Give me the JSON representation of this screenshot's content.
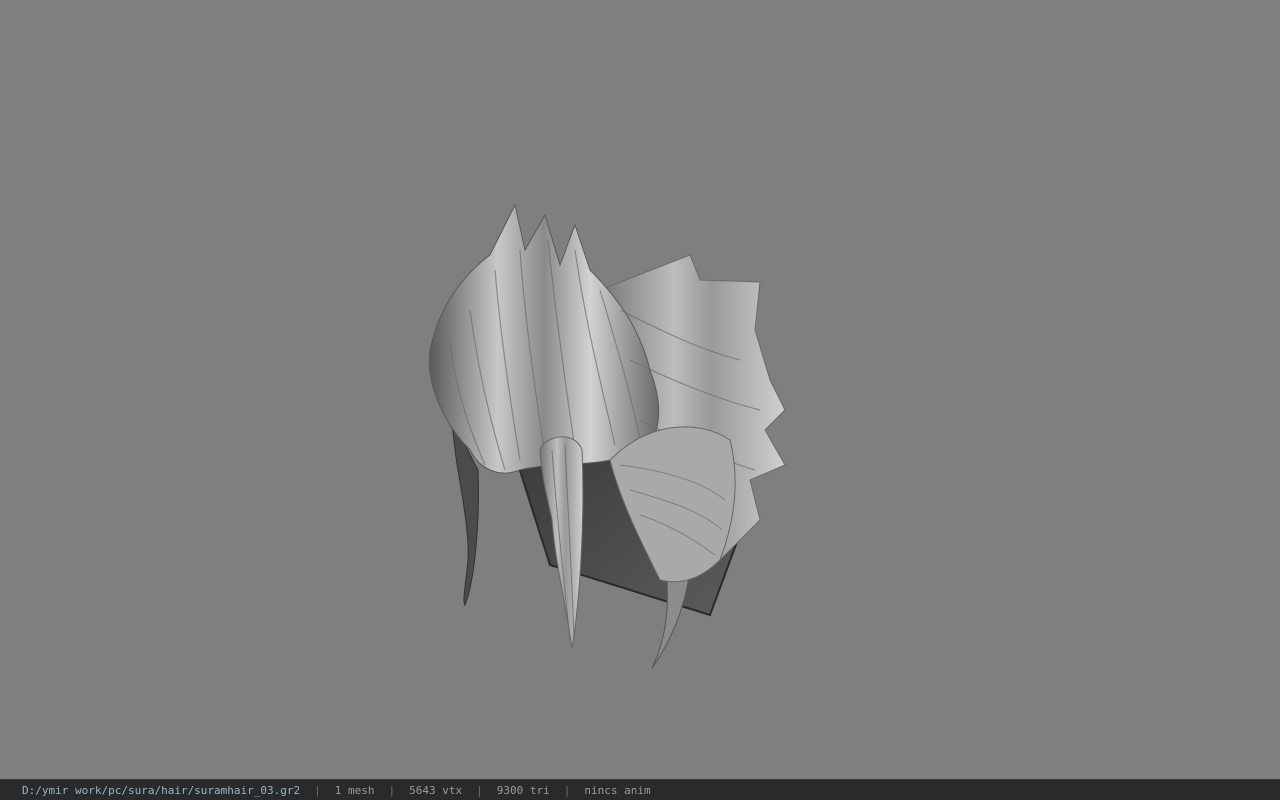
{
  "viewport": {
    "background_color": "#7f7f7f",
    "model_icon": "hair-mesh-model"
  },
  "statusbar": {
    "file_path": "D:/ymir work/pc/sura/hair/suramhair_03.gr2",
    "separator": "|",
    "mesh_count": "1 mesh",
    "vertex_count": "5643 vtx",
    "triangle_count": "9300 tri",
    "anim_status": "nincs anim"
  }
}
